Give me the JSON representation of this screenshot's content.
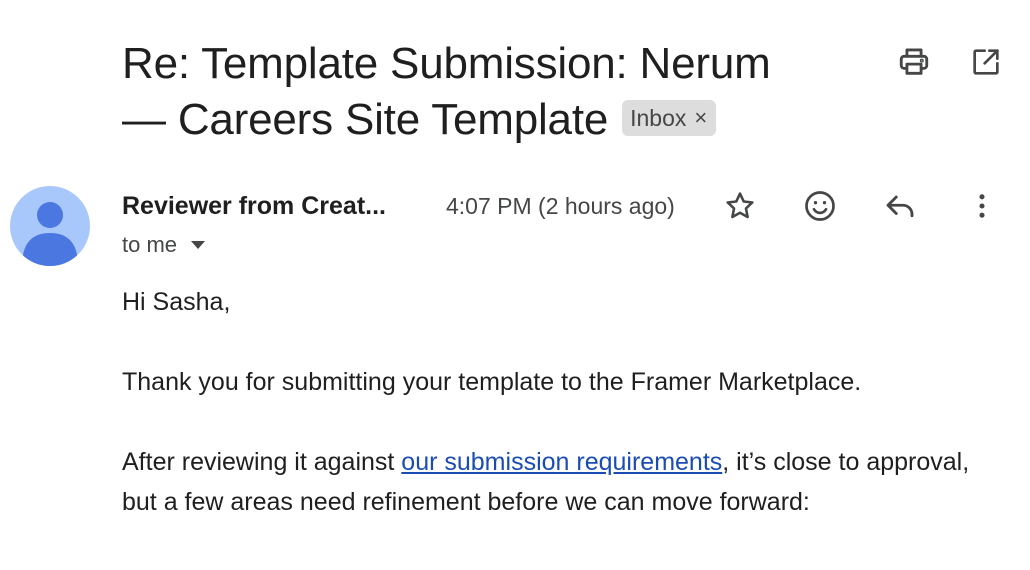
{
  "email": {
    "subject": "Re: Template Submission: Nerum — Careers Site Template",
    "label_chip": {
      "label": "Inbox",
      "remove_glyph": "×"
    },
    "top_actions": [
      {
        "icon": "print-icon"
      },
      {
        "icon": "open-in-new-window-icon"
      }
    ],
    "sender": {
      "name": "Reviewer from Creat...",
      "timestamp": "4:07 PM (2 hours ago)",
      "avatar_icon": "default-person-avatar",
      "recipients_label": "to me"
    },
    "message_actions": [
      {
        "icon": "star-icon"
      },
      {
        "icon": "emoji-reaction-icon"
      },
      {
        "icon": "reply-icon"
      },
      {
        "icon": "more-vert-icon"
      }
    ],
    "body": {
      "greeting": "Hi Sasha,",
      "para1": "Thank you for submitting your template to the Framer Marketplace.",
      "para2_before_link": "After reviewing it against ",
      "para2_link": "our submission requirements",
      "para2_after_link": ", it’s close to approval, but a few areas need refinement before we can move forward:"
    }
  },
  "colors": {
    "text_primary": "#1f1f1f",
    "text_secondary": "#444746",
    "chip_background": "#dddddd",
    "avatar_background": "#a8c7fa",
    "avatar_figure": "#4a78e0",
    "link": "#1a4db3"
  }
}
